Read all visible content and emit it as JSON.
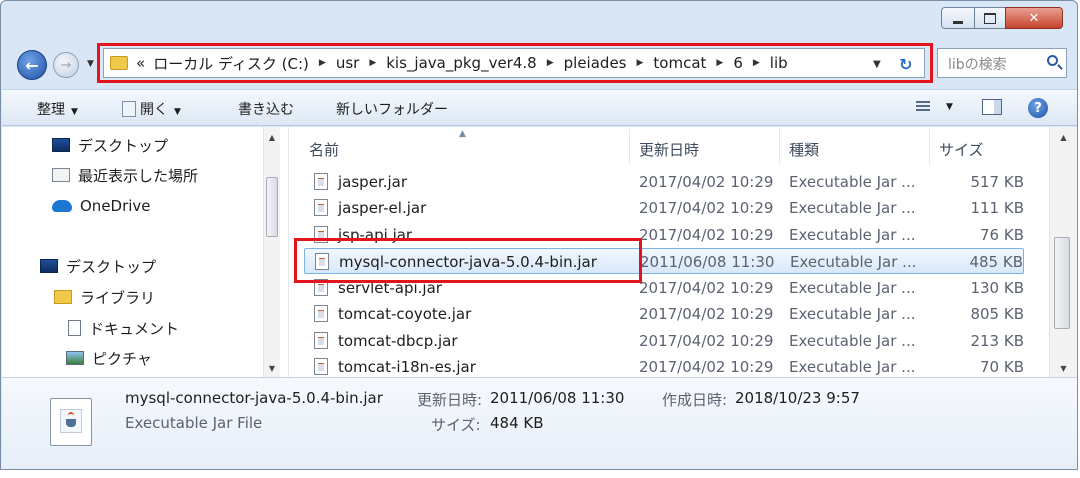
{
  "address": {
    "overflow": "«",
    "crumbs": [
      "ローカル ディスク (C:)",
      "usr",
      "kis_java_pkg_ver4.8",
      "pleiades",
      "tomcat",
      "6",
      "lib"
    ]
  },
  "search": {
    "placeholder": "libの検索"
  },
  "toolbar": {
    "organize": "整理",
    "open": "開く",
    "burn": "書き込む",
    "new_folder": "新しいフォルダー"
  },
  "nav": {
    "items": [
      {
        "label": "デスクトップ",
        "icon": "desktop-icon"
      },
      {
        "label": "最近表示した場所",
        "icon": "recent-places-icon"
      },
      {
        "label": "OneDrive",
        "icon": "onedrive-icon"
      },
      {
        "label": "デスクトップ",
        "icon": "desktop-icon"
      },
      {
        "label": "ライブラリ",
        "icon": "library-icon"
      },
      {
        "label": "ドキュメント",
        "icon": "document-icon"
      },
      {
        "label": "ピクチャ",
        "icon": "picture-icon"
      }
    ]
  },
  "columns": {
    "name": "名前",
    "date": "更新日時",
    "type": "種類",
    "size": "サイズ"
  },
  "files": [
    {
      "name": "jasper.jar",
      "date": "2017/04/02 10:29",
      "type": "Executable Jar ...",
      "size": "517 KB"
    },
    {
      "name": "jasper-el.jar",
      "date": "2017/04/02 10:29",
      "type": "Executable Jar ...",
      "size": "111 KB"
    },
    {
      "name": "jsp-api.jar",
      "date": "2017/04/02 10:29",
      "type": "Executable Jar ...",
      "size": "76 KB"
    },
    {
      "name": "mysql-connector-java-5.0.4-bin.jar",
      "date": "2011/06/08 11:30",
      "type": "Executable Jar ...",
      "size": "485 KB",
      "selected": true
    },
    {
      "name": "servlet-api.jar",
      "date": "2017/04/02 10:29",
      "type": "Executable Jar ...",
      "size": "130 KB"
    },
    {
      "name": "tomcat-coyote.jar",
      "date": "2017/04/02 10:29",
      "type": "Executable Jar ...",
      "size": "805 KB"
    },
    {
      "name": "tomcat-dbcp.jar",
      "date": "2017/04/02 10:29",
      "type": "Executable Jar ...",
      "size": "213 KB"
    },
    {
      "name": "tomcat-i18n-es.jar",
      "date": "2017/04/02 10:29",
      "type": "Executable Jar ...",
      "size": "70 KB"
    }
  ],
  "details": {
    "filename": "mysql-connector-java-5.0.4-bin.jar",
    "filetype": "Executable Jar File",
    "modified_label": "更新日時:",
    "modified_value": "2011/06/08 11:30",
    "created_label": "作成日時:",
    "created_value": "2018/10/23 9:57",
    "size_label": "サイズ:",
    "size_value": "484 KB"
  },
  "colors": {
    "highlight": "#e4141e",
    "selection": "#d7e8fb",
    "chrome": "#d9e6f5"
  }
}
